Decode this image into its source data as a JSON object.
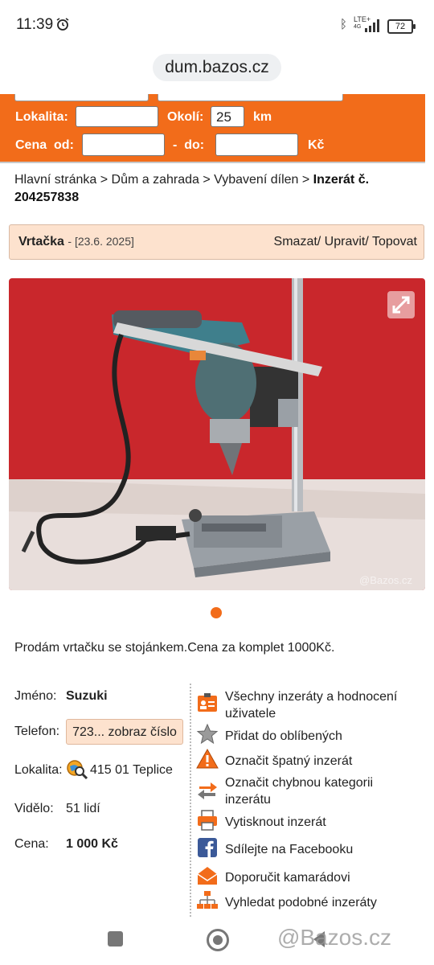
{
  "status_bar": {
    "time": "11:39",
    "network": "LTE+",
    "network_sub": "4G",
    "battery": "72"
  },
  "browser": {
    "url": "dum.bazos.cz"
  },
  "search_form": {
    "location_label": "Lokalita:",
    "location_value": "",
    "radius_label": "Okolí:",
    "radius_value": "25",
    "radius_unit": "km",
    "price_label": "Cena  od:",
    "price_from": "",
    "price_sep": "-  do:",
    "price_to": "",
    "currency": "Kč"
  },
  "breadcrumb": {
    "items": [
      "Hlavní stránka",
      "Dům a zahrada",
      "Vybavení dílen"
    ],
    "separator": ">",
    "current": "Inzerát č. 204257838"
  },
  "ad_header": {
    "title": "Vrtačka",
    "date": "- [23.6. 2025]",
    "actions": "Smazat/ Upravit/ Topovat"
  },
  "photo": {
    "watermark": "@Bazos.cz",
    "active_dot": 1
  },
  "description": "Prodám vrtačku se stojánkem.Cena za komplet 1000Kč.",
  "details": {
    "name_label": "Jméno:",
    "name_value": "Suzuki",
    "phone_label": "Telefon:",
    "phone_button": "723... zobraz číslo",
    "location_label": "Lokalita:",
    "location_value": "415 01 Teplice",
    "views_label": "Vidělo:",
    "views_value": "51 lidí",
    "price_label": "Cena:",
    "price_value": "1 000 Kč"
  },
  "actions": [
    {
      "label": "Všechny inzeráty a hodnocení uživatele",
      "icon": "user-card-icon"
    },
    {
      "label": "Přidat do oblíbených",
      "icon": "star-icon"
    },
    {
      "label": "Označit špatný inzerát",
      "icon": "warning-icon"
    },
    {
      "label": "Označit chybnou kategorii inzerátu",
      "icon": "swap-arrows-icon"
    },
    {
      "label": "Vytisknout inzerát",
      "icon": "printer-icon"
    },
    {
      "label": "Sdílejte na Facebooku",
      "icon": "facebook-icon"
    },
    {
      "label": "Doporučit kamarádovi",
      "icon": "envelope-icon"
    },
    {
      "label": "Vyhledat podobné inzeráty",
      "icon": "sitemap-icon"
    }
  ],
  "bottom_watermark": "@Bazos.cz",
  "colors": {
    "accent": "#f26c1a",
    "header_bg": "#fde2ce",
    "photo_wall": "#c9272c"
  }
}
